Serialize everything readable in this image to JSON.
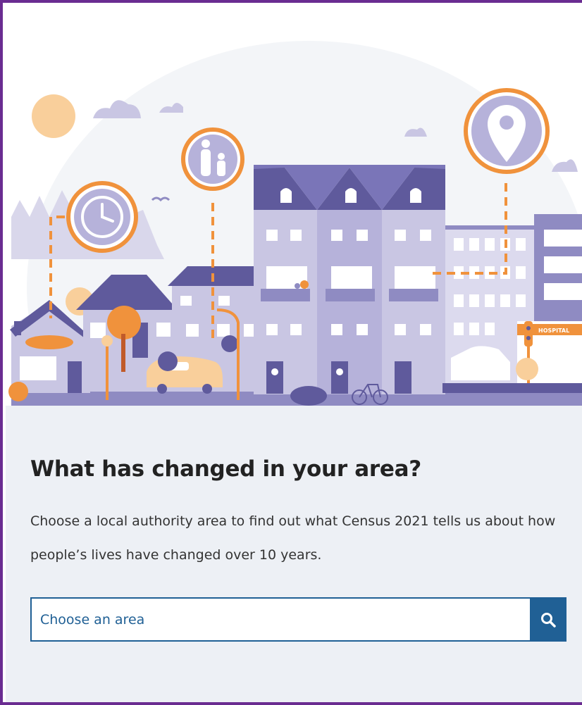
{
  "section": {
    "title": "What has changed in your area?",
    "description": "Choose a local authority area to find out what Census 2021 tells us about how people’s lives have changed over 10 years."
  },
  "search": {
    "placeholder": "Choose an area",
    "button_icon": "search-icon"
  },
  "illustration": {
    "hospital_sign": "HOSPITAL",
    "colors": {
      "purple_dark": "#5f5a9c",
      "purple_mid": "#8f8bc2",
      "lavender": "#c9c6e3",
      "lavender_light": "#dcdaee",
      "orange": "#f0923c",
      "peach": "#f9cf9b",
      "sky": "#f3f5f8"
    }
  },
  "theme": {
    "frame_border": "#6a2c91",
    "panel_bg": "#edf0f5",
    "accent_blue": "#206095"
  }
}
